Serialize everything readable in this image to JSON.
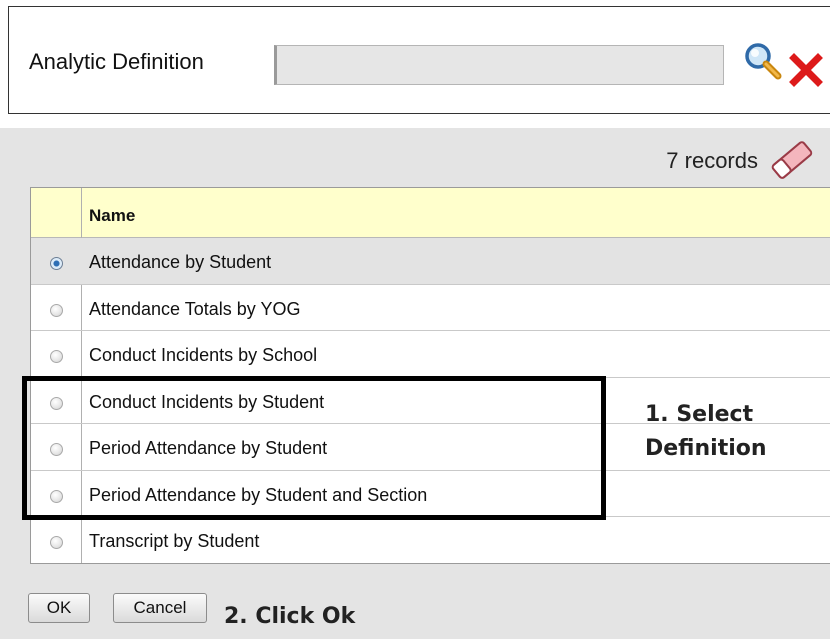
{
  "field": {
    "label": "Analytic Definition",
    "value": "",
    "search_icon": "magnifier-icon",
    "clear_icon": "red-x-icon"
  },
  "list": {
    "record_count": "7 records",
    "clear_icon": "eraser-icon",
    "column_header": "Name",
    "rows": [
      {
        "label": "Attendance by Student",
        "selected": true
      },
      {
        "label": "Attendance Totals by YOG",
        "selected": false
      },
      {
        "label": "Conduct Incidents by School",
        "selected": false
      },
      {
        "label": "Conduct Incidents by Student",
        "selected": false
      },
      {
        "label": "Period Attendance by Student",
        "selected": false
      },
      {
        "label": "Period Attendance by Student and Section",
        "selected": false
      },
      {
        "label": "Transcript by Student",
        "selected": false
      }
    ]
  },
  "annotations": {
    "step1_line1": "1. Select",
    "step1_line2": "Definition",
    "step2": "2. Click Ok"
  },
  "buttons": {
    "ok": "OK",
    "cancel": "Cancel"
  },
  "colors": {
    "header_bg": "#ffffcc",
    "panel_bg": "#e4e4e4",
    "clear_x": "#dd1a1a"
  }
}
